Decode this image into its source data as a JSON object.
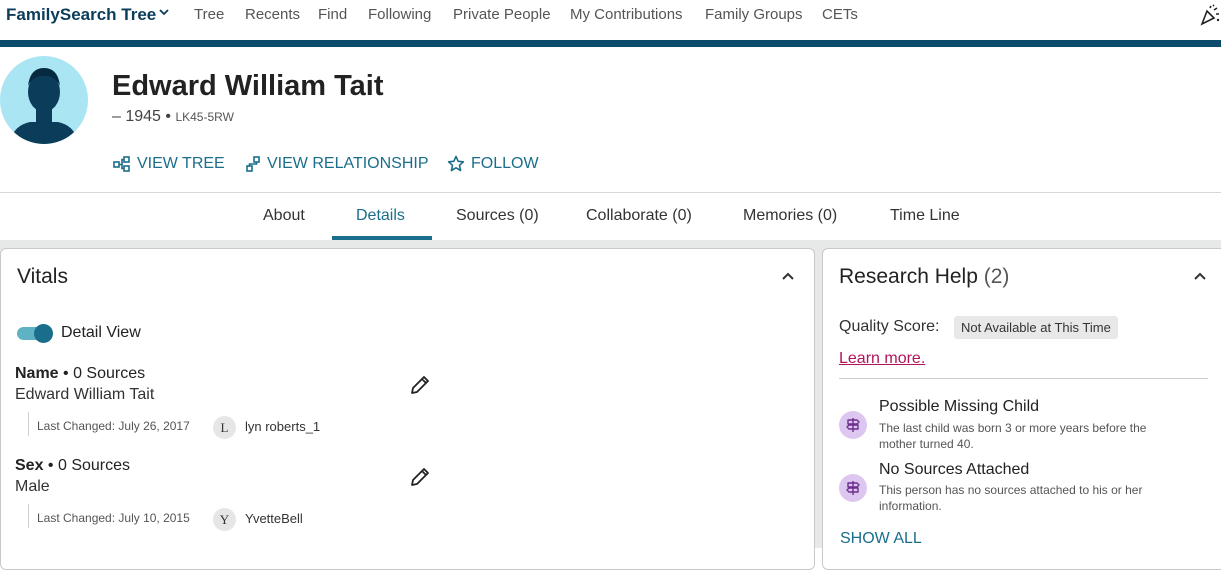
{
  "nav": {
    "brand": "FamilySearch Tree",
    "items": [
      "Tree",
      "Recents",
      "Find",
      "Following",
      "Private People",
      "My Contributions",
      "Family Groups",
      "CETs"
    ]
  },
  "person": {
    "name": "Edward William Tait",
    "dates": "– 1945",
    "separator": "•",
    "pid": "LK45-5RW"
  },
  "actions": {
    "view_tree": "VIEW TREE",
    "view_relationship": "VIEW RELATIONSHIP",
    "follow": "FOLLOW"
  },
  "tabs": [
    "About",
    "Details",
    "Sources (0)",
    "Collaborate (0)",
    "Memories (0)",
    "Time Line"
  ],
  "active_tab": "Details",
  "vitals": {
    "title": "Vitals",
    "detail_view_label": "Detail View",
    "detail_view_on": true,
    "name": {
      "label": "Name",
      "sources": "• 0 Sources",
      "value": "Edward William Tait",
      "last_changed": "Last Changed: July 26, 2017",
      "user_initial": "L",
      "user": "lyn roberts_1"
    },
    "sex": {
      "label": "Sex",
      "sources": "• 0 Sources",
      "value": "Male",
      "last_changed": "Last Changed: July 10, 2015",
      "user_initial": "Y",
      "user": "YvetteBell"
    }
  },
  "research": {
    "title": "Research Help",
    "count": "(2)",
    "quality_label": "Quality Score:",
    "quality_value": "Not Available at This Time",
    "learn_more": "Learn more.",
    "hints": [
      {
        "title": "Possible Missing Child",
        "desc": "The last child was born 3 or more years before the mother turned 40."
      },
      {
        "title": "No Sources Attached",
        "desc": "This person has no sources attached to his or her information."
      }
    ],
    "show_all": "SHOW ALL"
  },
  "colors": {
    "brand": "#0b3d5a",
    "accent": "#1a6e8c",
    "link_pink": "#b0155a",
    "hint_bg": "#ddc7f0"
  }
}
